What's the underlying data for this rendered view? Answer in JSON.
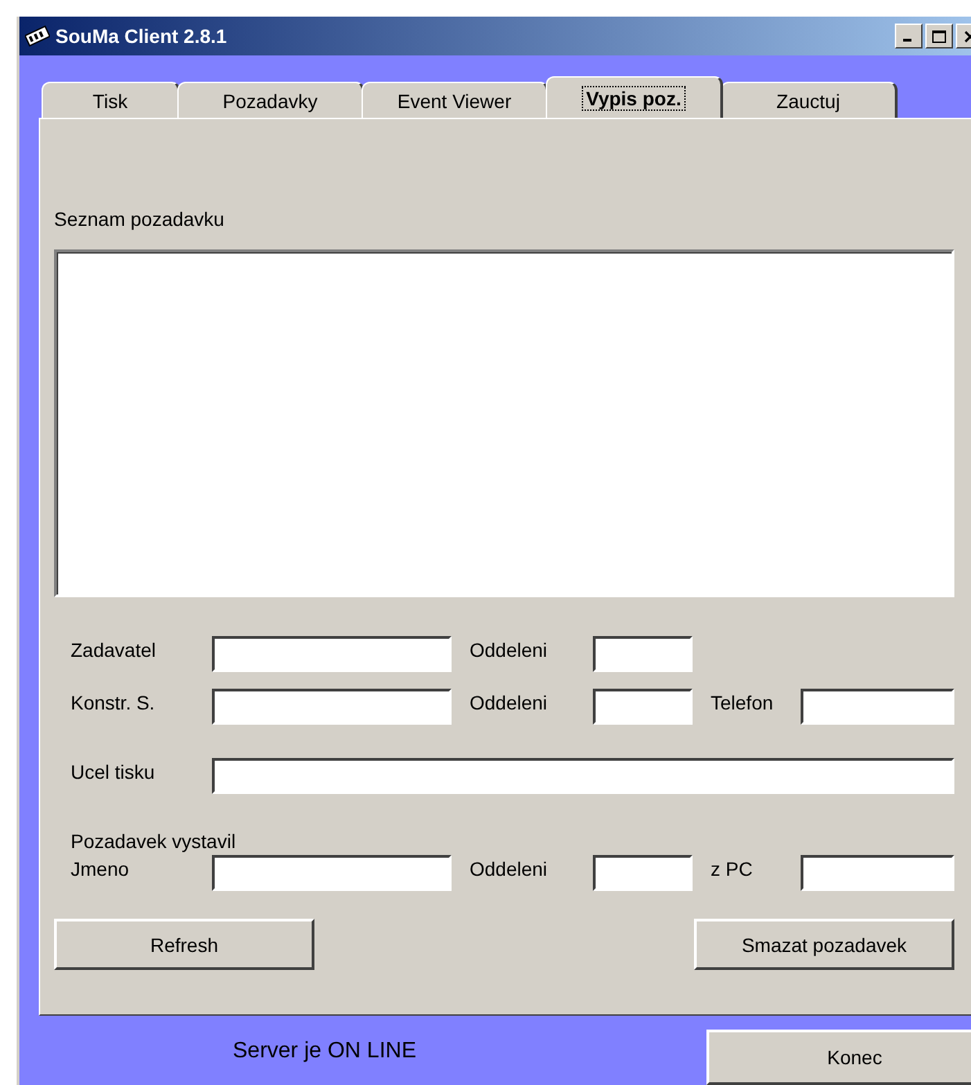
{
  "window": {
    "title": "SouMa Client 2.8.1"
  },
  "tabs": [
    {
      "label": "Tisk",
      "selected": false
    },
    {
      "label": "Pozadavky",
      "selected": false
    },
    {
      "label": "Event Viewer",
      "selected": false
    },
    {
      "label": "Vypis poz.",
      "selected": true
    },
    {
      "label": "Zauctuj",
      "selected": false
    }
  ],
  "list_label": "Seznam pozadavku",
  "form_rows": [
    {
      "kind": "fields",
      "cells": [
        {
          "kind": "label",
          "text": "Zadavatel"
        },
        {
          "kind": "name_field"
        },
        {
          "kind": "label",
          "text": "Oddeleni"
        },
        {
          "kind": "dept_field"
        }
      ]
    },
    {
      "kind": "fields",
      "cells": [
        {
          "kind": "label",
          "text": "Konstr. S."
        },
        {
          "kind": "name_field"
        },
        {
          "kind": "label",
          "text": "Oddeleni"
        },
        {
          "kind": "dept_field"
        },
        {
          "kind": "label",
          "text": "Telefon"
        },
        {
          "kind": "field"
        }
      ]
    },
    {
      "kind": "fields",
      "cells": [
        {
          "kind": "label",
          "text": "Ucel tisku"
        },
        {
          "kind": "long_field"
        }
      ]
    },
    {
      "kind": "heading",
      "text": "Pozadavek vystavil"
    },
    {
      "kind": "fields",
      "cells": [
        {
          "kind": "label",
          "text": "Jmeno"
        },
        {
          "kind": "name_field"
        },
        {
          "kind": "label",
          "text": "Oddeleni"
        },
        {
          "kind": "dept_field"
        },
        {
          "kind": "label",
          "text": "z PC"
        },
        {
          "kind": "field"
        }
      ]
    }
  ],
  "buttons": [
    "Refresh",
    "Smazat pozadavek"
  ],
  "status": "Server je ON LINE",
  "exit_button": "Konec"
}
